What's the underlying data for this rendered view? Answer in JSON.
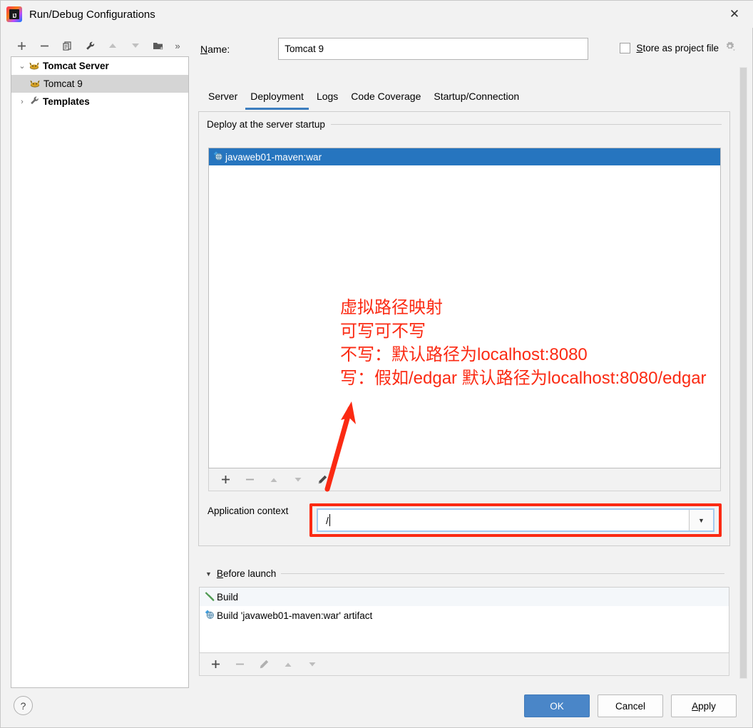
{
  "window": {
    "title": "Run/Debug Configurations",
    "app_icon": "intellij-idea-icon",
    "close_label": "✕"
  },
  "sidebar": {
    "toolbar": [
      {
        "name": "add-configuration-button",
        "glyph": "+",
        "enabled": true
      },
      {
        "name": "remove-configuration-button",
        "glyph": "−",
        "enabled": true
      },
      {
        "name": "copy-configuration-button",
        "glyph": "⧉",
        "enabled": true
      },
      {
        "name": "edit-templates-button",
        "glyph": "🔧",
        "enabled": true
      },
      {
        "name": "move-up-button",
        "glyph": "▲",
        "enabled": false
      },
      {
        "name": "move-down-button",
        "glyph": "▼",
        "enabled": false
      },
      {
        "name": "create-folder-button",
        "glyph": "🗀",
        "enabled": true
      },
      {
        "name": "more-options-button",
        "glyph": "»",
        "enabled": true
      }
    ],
    "tree": [
      {
        "label": "Tomcat Server",
        "icon": "tomcat-icon",
        "twisty": "⌄",
        "bold": true,
        "indent": 0,
        "selected": false
      },
      {
        "label": "Tomcat 9",
        "icon": "tomcat-icon",
        "twisty": "",
        "bold": false,
        "indent": 1,
        "selected": true
      },
      {
        "label": "Templates",
        "icon": "wrench-icon",
        "twisty": "›",
        "bold": true,
        "indent": 0,
        "selected": false
      }
    ]
  },
  "header": {
    "name_label": "Name:",
    "name_label_mnemonic": "N",
    "name_value": "Tomcat 9",
    "store_as_project_file_label": "Store as project file",
    "store_as_project_file_mnemonic": "S",
    "store_as_project_file_checked": false,
    "gear_icon": "gear-icon"
  },
  "tabs": [
    {
      "label": "Server",
      "active": false
    },
    {
      "label": "Deployment",
      "active": true
    },
    {
      "label": "Logs",
      "active": false
    },
    {
      "label": "Code Coverage",
      "active": false
    },
    {
      "label": "Startup/Connection",
      "active": false
    }
  ],
  "deployment": {
    "group_title": "Deploy at the server startup",
    "items": [
      {
        "label": "javaweb01-maven:war",
        "icon": "artifact-icon",
        "selected": true
      }
    ],
    "toolbar": [
      {
        "name": "add-artifact-button",
        "glyph": "+",
        "enabled": true
      },
      {
        "name": "remove-artifact-button",
        "glyph": "−",
        "enabled": false
      },
      {
        "name": "move-artifact-up-button",
        "glyph": "▲",
        "enabled": false
      },
      {
        "name": "move-artifact-down-button",
        "glyph": "▼",
        "enabled": false
      },
      {
        "name": "edit-artifact-button",
        "glyph": "✎",
        "enabled": true
      }
    ],
    "application_context_label": "Application context",
    "application_context_value": "/",
    "dropdown_arrow": "▼"
  },
  "annotation": {
    "color": "#fb2a13",
    "lines": [
      "虚拟路径映射",
      "可写可不写",
      "不写：默认路径为localhost:8080",
      "写：假如/edgar 默认路径为localhost:8080/edgar"
    ],
    "arrow": "red-arrow-annotation",
    "highlight_target": "application-context-combobox"
  },
  "before_launch": {
    "title": "Before launch",
    "title_mnemonic": "B",
    "collapse_glyph": "▼",
    "items": [
      {
        "label": "Build",
        "icon": "build-hammer-icon"
      },
      {
        "label": "Build 'javaweb01-maven:war' artifact",
        "icon": "artifact-icon"
      }
    ],
    "toolbar": [
      {
        "name": "add-before-launch-task-button",
        "glyph": "+",
        "enabled": true
      },
      {
        "name": "remove-before-launch-task-button",
        "glyph": "−",
        "enabled": false
      },
      {
        "name": "edit-before-launch-task-button",
        "glyph": "✎",
        "enabled": false
      },
      {
        "name": "move-task-up-button",
        "glyph": "▲",
        "enabled": false
      },
      {
        "name": "move-task-down-button",
        "glyph": "▼",
        "enabled": false
      }
    ]
  },
  "footer": {
    "help_label": "?",
    "ok_label": "OK",
    "cancel_label": "Cancel",
    "apply_label": "Apply",
    "apply_mnemonic": "A"
  },
  "colors": {
    "selection_blue": "#2675bf",
    "tab_underline": "#3c7dbf",
    "annotation_red": "#fb2a13",
    "primary_button": "#4a86c8",
    "dialog_bg": "#f2f2f2"
  }
}
